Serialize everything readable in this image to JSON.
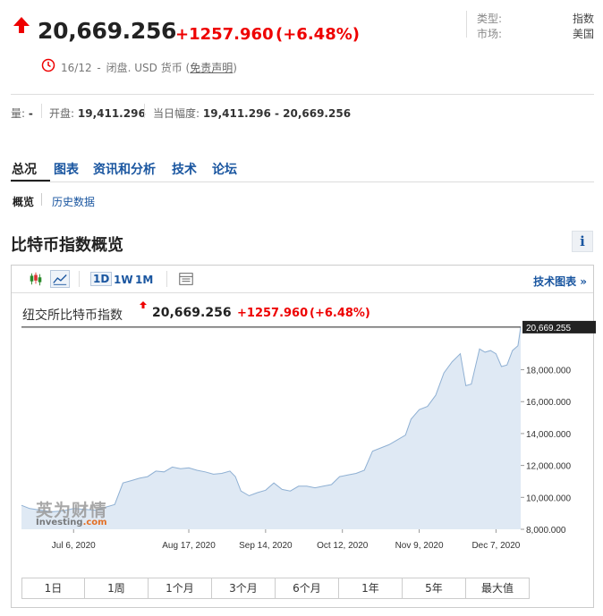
{
  "quote": {
    "price": "20,669.256",
    "change": "+1257.960",
    "change_pct": "(+6.48%)",
    "date": "16/12",
    "sep1": "-",
    "market_status": "闭盘.",
    "currency": "USD 货币",
    "disclaimer_open": "(",
    "disclaimer": "免责声明",
    "disclaimer_close": ")"
  },
  "meta": {
    "type_label": "类型:",
    "type_value": "指数",
    "market_label": "市场:",
    "market_value": "美国"
  },
  "stats": {
    "volume_label": "量:",
    "volume_value": "-",
    "open_label": "开盘:",
    "open_value": "19,411.296",
    "range_label": "当日幅度:",
    "range_value": "19,411.296 - 20,669.256"
  },
  "tabs": [
    "总况",
    "图表",
    "资讯和分析",
    "技术",
    "论坛"
  ],
  "subtabs": [
    "概览",
    "历史数据"
  ],
  "section": {
    "title": "比特币指数概览",
    "info": "i"
  },
  "toolbar": {
    "ranges": [
      "1D",
      "1W",
      "1M"
    ],
    "tech_link": "技术图表 »"
  },
  "chart_header": {
    "name": "纽交所比特币指数",
    "price": "20,669.256",
    "change": "+1257.960",
    "change_pct": "(+6.48%)"
  },
  "watermark": {
    "cn": "英为财情",
    "en": "Investing",
    "en_suffix": ".com"
  },
  "range_buttons": [
    "1日",
    "1周",
    "1个月",
    "3个月",
    "6个月",
    "1年",
    "5年",
    "最大值"
  ],
  "colors": {
    "up": "#e00000",
    "link": "#1a56a0",
    "area_fill": "#dfe9f4",
    "area_line": "#8fb0d3"
  },
  "chart_data": {
    "type": "area",
    "title": "纽交所比特币指数",
    "x_ticks": [
      "Jul 6, 2020",
      "Aug 17, 2020",
      "Sep 14, 2020",
      "Oct 12, 2020",
      "Nov 9, 2020",
      "Dec 7, 2020"
    ],
    "y_ticks": [
      "8,000.000",
      "10,000.000",
      "12,000.000",
      "14,000.000",
      "16,000.000",
      "18,000.000"
    ],
    "last_value_label": "20,669.255",
    "ylim": [
      8000,
      21000
    ],
    "x_range": [
      "2020-06-17",
      "2020-12-16"
    ],
    "x_tick_dates": [
      "2020-07-06",
      "2020-08-17",
      "2020-09-14",
      "2020-10-12",
      "2020-11-09",
      "2020-12-07"
    ],
    "series": [
      {
        "x": [
          "2020-06-17",
          "2020-06-20",
          "2020-06-24",
          "2020-06-28",
          "2020-07-02",
          "2020-07-06",
          "2020-07-10",
          "2020-07-14",
          "2020-07-18",
          "2020-07-21",
          "2020-07-24",
          "2020-07-27",
          "2020-07-30",
          "2020-08-02",
          "2020-08-05",
          "2020-08-08",
          "2020-08-11",
          "2020-08-14",
          "2020-08-17",
          "2020-08-20",
          "2020-08-23",
          "2020-08-26",
          "2020-08-29",
          "2020-09-01",
          "2020-09-03",
          "2020-09-05",
          "2020-09-08",
          "2020-09-11",
          "2020-09-14",
          "2020-09-17",
          "2020-09-20",
          "2020-09-23",
          "2020-09-26",
          "2020-09-29",
          "2020-10-02",
          "2020-10-05",
          "2020-10-08",
          "2020-10-11",
          "2020-10-14",
          "2020-10-17",
          "2020-10-20",
          "2020-10-23",
          "2020-10-26",
          "2020-10-29",
          "2020-11-01",
          "2020-11-04",
          "2020-11-06",
          "2020-11-09",
          "2020-11-12",
          "2020-11-15",
          "2020-11-18",
          "2020-11-21",
          "2020-11-24",
          "2020-11-26",
          "2020-11-28",
          "2020-12-01",
          "2020-12-03",
          "2020-12-05",
          "2020-12-07",
          "2020-12-09",
          "2020-12-11",
          "2020-12-13",
          "2020-12-15",
          "2020-12-16"
        ],
        "y": [
          9500,
          9300,
          9200,
          9100,
          9150,
          9300,
          9250,
          9200,
          9400,
          9550,
          10900,
          11050,
          11200,
          11300,
          11650,
          11600,
          11900,
          11800,
          11850,
          11700,
          11600,
          11450,
          11500,
          11650,
          11300,
          10400,
          10100,
          10300,
          10450,
          10900,
          10500,
          10400,
          10700,
          10700,
          10600,
          10700,
          10800,
          11300,
          11400,
          11500,
          11700,
          12900,
          13100,
          13300,
          13600,
          13900,
          14900,
          15500,
          15700,
          16400,
          17800,
          18500,
          19000,
          17000,
          17100,
          19300,
          19100,
          19200,
          19000,
          18200,
          18300,
          19200,
          19500,
          20669
        ]
      }
    ]
  }
}
